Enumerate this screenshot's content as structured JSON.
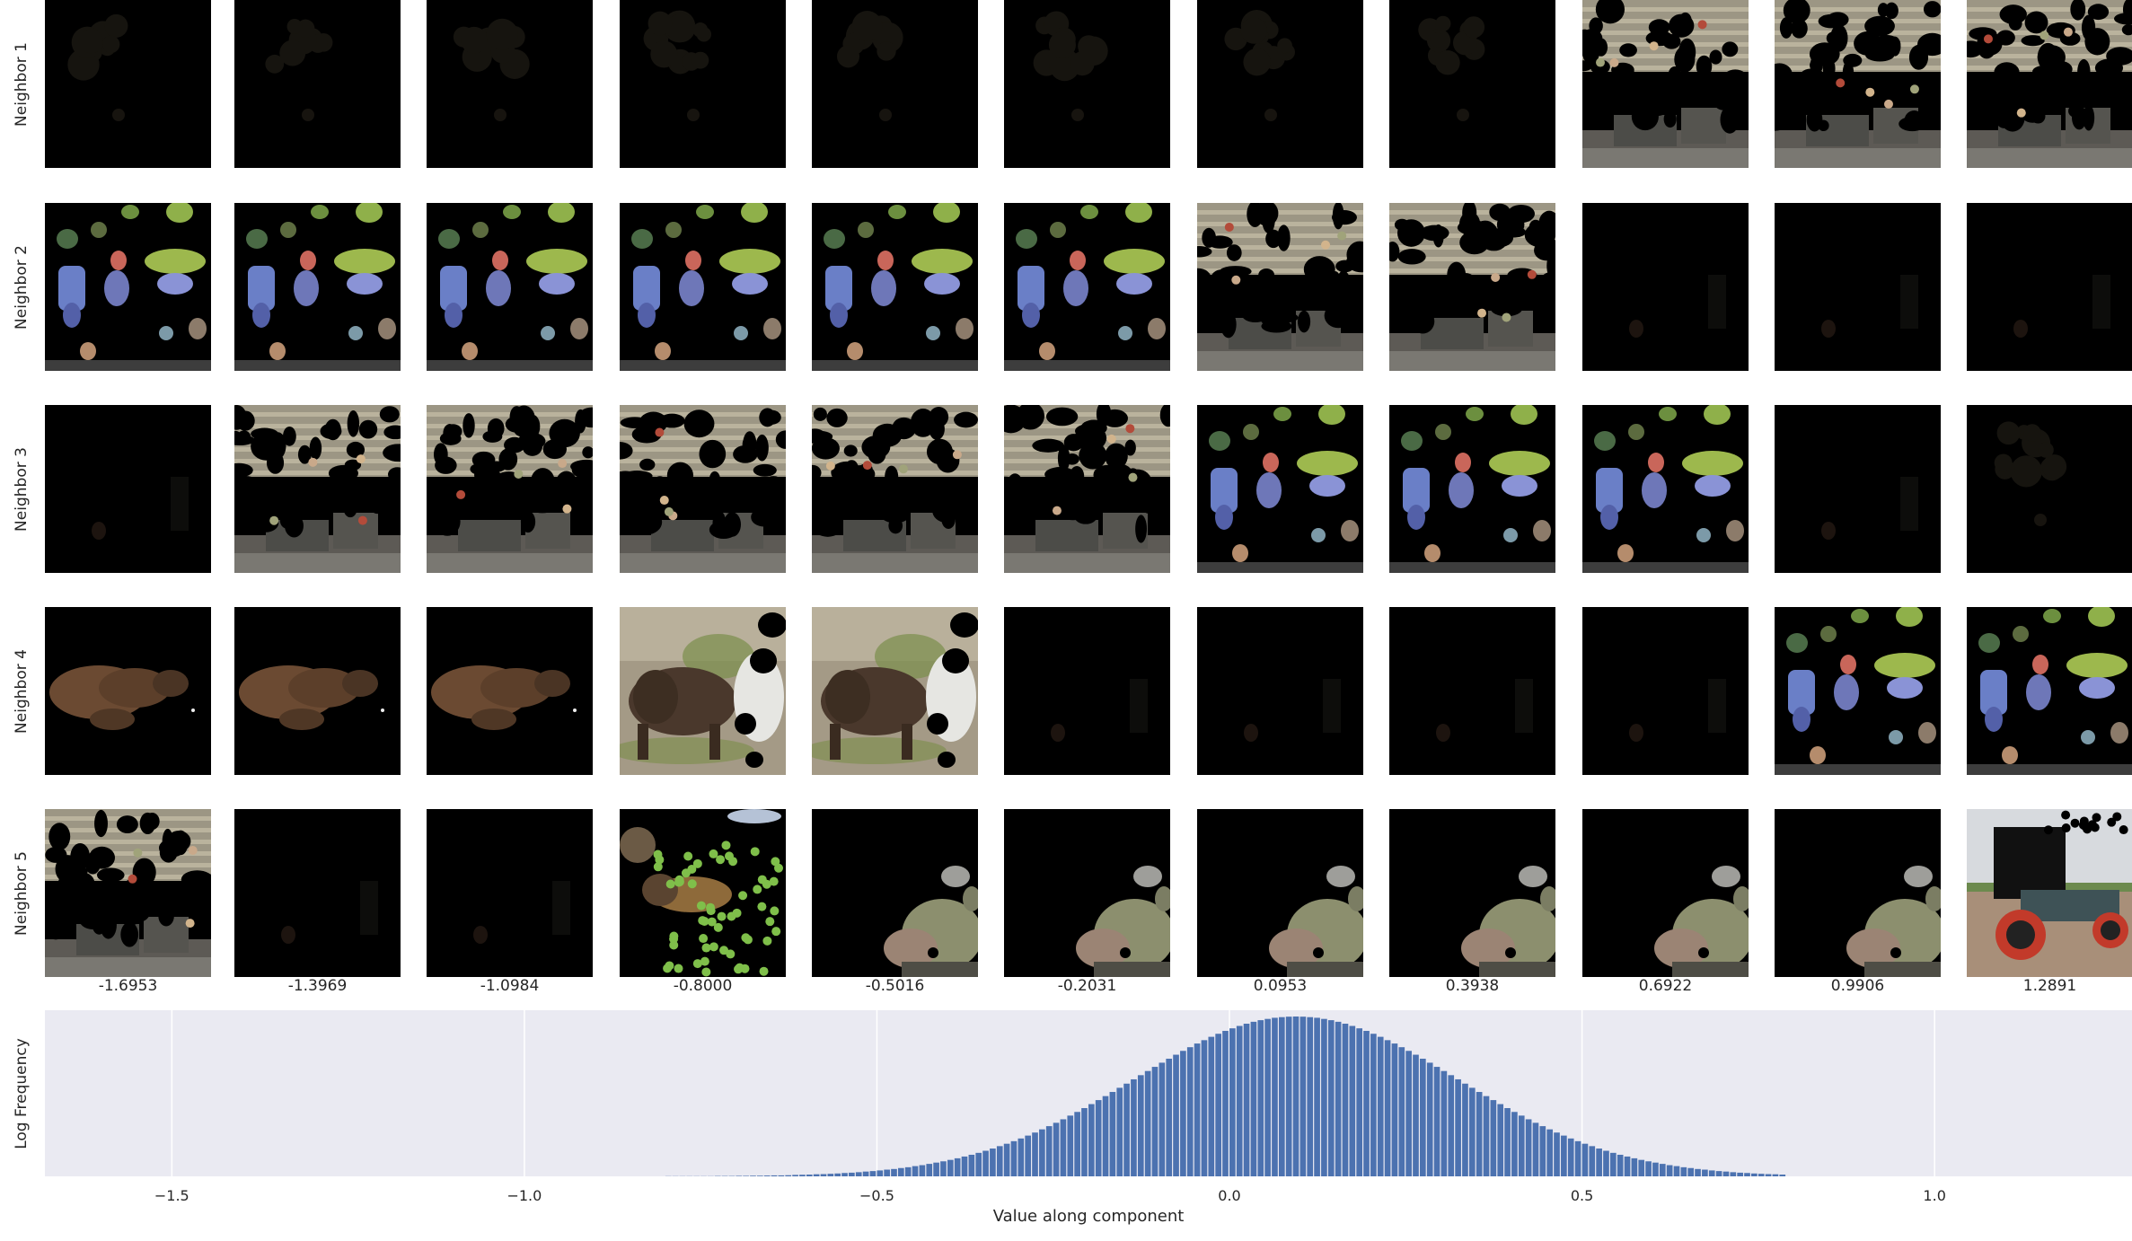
{
  "grid": {
    "row_labels": [
      "Neighbor 1",
      "Neighbor 2",
      "Neighbor 3",
      "Neighbor 4",
      "Neighbor 5"
    ],
    "column_values": [
      "-1.6953",
      "-1.3969",
      "-1.0984",
      "-0.8000",
      "-0.5016",
      "-0.2031",
      "0.0953",
      "0.3938",
      "0.6922",
      "0.9906",
      "1.2891"
    ],
    "cells": [
      [
        "dim",
        "dim",
        "dim",
        "dim",
        "dim",
        "dim",
        "dim",
        "dim",
        "street",
        "street",
        "street"
      ],
      [
        "blobs",
        "blobs",
        "blobs",
        "blobs",
        "blobs",
        "blobs",
        "street",
        "street",
        "dark",
        "dark",
        "dark"
      ],
      [
        "dark",
        "street",
        "street",
        "street",
        "street",
        "street",
        "blobs",
        "blobs",
        "blobs",
        "dark",
        "dim"
      ],
      [
        "brown",
        "brown",
        "brown",
        "dog",
        "dog",
        "dark",
        "dark",
        "dark",
        "dark",
        "blobs",
        "blobs"
      ],
      [
        "street",
        "dark",
        "dark",
        "green",
        "truck",
        "truck",
        "truck",
        "truck",
        "truck",
        "truck",
        "tractor"
      ]
    ]
  },
  "chart_data": {
    "type": "bar",
    "title": "",
    "xlabel": "Value along component",
    "ylabel": "Log Frequency",
    "xlim": [
      -1.68,
      1.28
    ],
    "x_ticks": [
      "−1.5",
      "−1.0",
      "−0.5",
      "0.0",
      "0.5",
      "1.0"
    ],
    "x_tick_values": [
      -1.5,
      -1.0,
      -0.5,
      0.0,
      0.5,
      1.0
    ],
    "grid": true,
    "bar_color": "#4c72b0",
    "background_color": "#eaeaf2",
    "bin_start": -0.96,
    "bin_width": 0.01,
    "values": []
  }
}
